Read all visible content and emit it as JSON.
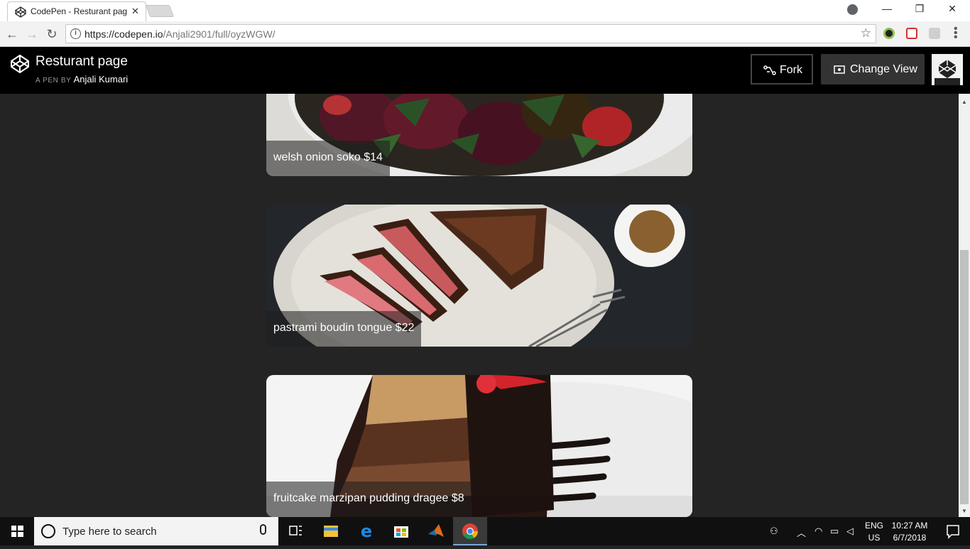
{
  "browser": {
    "tab_title": "CodePen - Resturant pag",
    "url_host": "https://codepen.io",
    "url_path": "/Anjali2901/full/oyzWGW/"
  },
  "codepen": {
    "pen_title": "Resturant page",
    "byline_prefix": "A PEN BY",
    "author": "Anjali Kumari",
    "fork_label": "Fork",
    "change_view_label": "Change View"
  },
  "menu_items": [
    {
      "caption": "welsh onion soko $14"
    },
    {
      "caption": "pastrami boudin tongue $22"
    },
    {
      "caption": "fruitcake marzipan pudding dragee $8"
    }
  ],
  "taskbar": {
    "search_placeholder": "Type here to search",
    "lang_top": "ENG",
    "lang_bottom": "US",
    "time": "10:27 AM",
    "date": "6/7/2018"
  },
  "colors": {
    "page_bg": "#242424",
    "header_bg": "#000000",
    "caption_bg": "rgba(30,30,30,0.55)"
  }
}
